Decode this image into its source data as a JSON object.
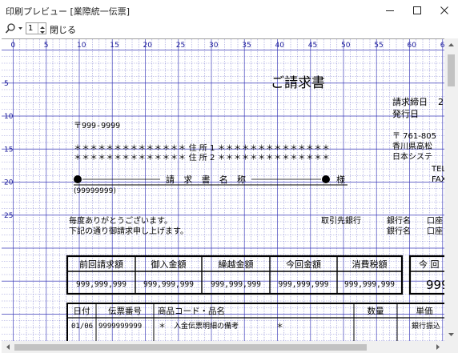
{
  "window": {
    "title": "印刷プレビュー [業際統一伝票]"
  },
  "toolbar": {
    "page_number": "1",
    "close_label": "閉じる",
    "icons": [
      "magnifier-icon",
      "dropdown-arrow-icon",
      "spin-up-icon",
      "spin-down-icon"
    ]
  },
  "ruler": {
    "top_labels": [
      "0",
      "5",
      "10",
      "15",
      "20",
      "25",
      "30",
      "35",
      "40",
      "45",
      "50",
      "55",
      "60",
      "65"
    ],
    "left_labels": [
      "5",
      "10",
      "15",
      "20",
      "25"
    ]
  },
  "invoice": {
    "title": "ご請求書",
    "postal": "〒999-9999",
    "address_line1": "＊＊＊＊＊＊＊＊＊＊＊＊＊＊ 住 所 1 ＊＊＊＊＊＊＊＊＊＊＊＊＊＊",
    "address_line2": "＊＊＊＊＊＊＊＊＊＊＊＊＊＊ 住 所 2 ＊＊＊＊＊＊＊＊＊＊＊＊＊＊",
    "recipient_name": "請 求 書 名 称",
    "honorific": "様",
    "customer_code": "(99999999)",
    "closing_date_label": "請求締日",
    "closing_date_value": "2",
    "issue_date_label": "発行日",
    "issuer_postal": "〒 761-805",
    "issuer_address": "香川県高松",
    "issuer_company": "日本システ",
    "issuer_tel": "TEL",
    "issuer_fax": "FAX",
    "greeting_line1": "毎度ありがとうございます。",
    "greeting_line2": "下記の通り御請求申し上げます。",
    "bank_label": "取引先銀行",
    "bank_name_label_1": "銀行名",
    "bank_account_label_1": "口座",
    "bank_name_label_2": "銀行名",
    "bank_account_label_2": "口座",
    "summary_headers": [
      "前回請求額",
      "御入金額",
      "繰越金額",
      "今回金額",
      "消費税額"
    ],
    "summary_values": [
      "999,999,999",
      "999,999,999",
      "999,999,999",
      "999,999,999",
      "999,999,999"
    ],
    "current_total_header": "今 回",
    "current_total_value": "999",
    "detail_headers": [
      "日付",
      "伝票番号",
      "商品コード・品名",
      "数量",
      "単価"
    ],
    "detail_row": [
      "01/06",
      "9999999999",
      "＊",
      "入金伝票明細の備考",
      "＊",
      "銀行振込"
    ]
  },
  "colors": {
    "grid_blue": "#3a3ab8",
    "ruler_blue": "#1a1a9a",
    "text_black": "#000000",
    "window_bg": "#ffffff",
    "scroll_bg": "#f0f0f0"
  }
}
